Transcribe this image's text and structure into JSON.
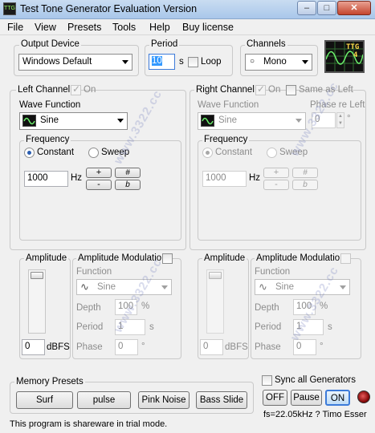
{
  "window": {
    "title": "Test Tone Generator Evaluation Version",
    "app_icon": "TTG"
  },
  "menu": [
    "File",
    "View",
    "Presets",
    "Tools",
    "Help",
    "Buy license"
  ],
  "output_device": {
    "label": "Output Device",
    "value": "Windows Default"
  },
  "period": {
    "label": "Period",
    "value": "10",
    "unit": "s",
    "loop_label": "Loop",
    "loop_checked": false
  },
  "channels": {
    "label": "Channels",
    "value": "Mono"
  },
  "logo": {
    "text": "TTG",
    "number": "4"
  },
  "left": {
    "title": "Left Channel",
    "on_label": "On",
    "on_checked": true,
    "wave_label": "Wave Function",
    "wave_value": "Sine",
    "frequency_label": "Frequency",
    "constant_label": "Constant",
    "sweep_label": "Sweep",
    "mode": "constant",
    "freq_value": "1000",
    "freq_unit": "Hz",
    "amplitude_label": "Amplitude",
    "amplitude_value": "0",
    "amplitude_unit": "dBFS",
    "amplitude_level": 1.0,
    "am_label": "Amplitude Modulation",
    "am_checked": false,
    "function_label": "Function",
    "function_value": "Sine",
    "depth_label": "Depth",
    "depth_value": "100",
    "depth_unit": "%",
    "period_label": "Period",
    "period_value": "1",
    "period_unit": "s",
    "phase_label": "Phase",
    "phase_value": "0",
    "phase_unit": "°"
  },
  "right": {
    "title": "Right Channel",
    "on_label": "On",
    "on_checked": true,
    "same_label": "Same as Left",
    "same_checked": false,
    "wave_label": "Wave Function",
    "wave_value": "Sine",
    "phase_left_label": "Phase re Left",
    "phase_left_value": "0",
    "phase_left_unit": "°",
    "frequency_label": "Frequency",
    "constant_label": "Constant",
    "sweep_label": "Sweep",
    "mode": "constant",
    "freq_value": "1000",
    "freq_unit": "Hz",
    "amplitude_label": "Amplitude",
    "amplitude_value": "0",
    "amplitude_unit": "dBFS",
    "amplitude_level": 1.0,
    "am_label": "Amplitude Modulation",
    "am_checked": false,
    "function_label": "Function",
    "function_value": "Sine",
    "depth_label": "Depth",
    "depth_value": "100",
    "depth_unit": "%",
    "period_label": "Period",
    "period_value": "1",
    "period_unit": "s",
    "phase_label": "Phase",
    "phase_value": "0",
    "phase_unit": "°"
  },
  "freq_buttons": {
    "plus": "+",
    "minus": "-",
    "sharp": "#",
    "flat": "b"
  },
  "presets": {
    "label": "Memory Presets",
    "items": [
      "Surf",
      "pulse",
      "Pink Noise",
      "Bass Slide"
    ]
  },
  "sync": {
    "label": "Sync all Generators",
    "checked": false
  },
  "transport": {
    "off": "OFF",
    "pause": "Pause",
    "on": "ON"
  },
  "status": {
    "message": "This program is shareware in trial mode.",
    "info": "fs=22.05kHz ? Timo Esser"
  },
  "watermark": "www.3322.cc",
  "colors": {
    "accent": "#2a5db0",
    "led": "#b00000",
    "scope_bg": "#101010",
    "scope_wave": "#6cf06c",
    "active_on_border": "#3d7bd9"
  }
}
